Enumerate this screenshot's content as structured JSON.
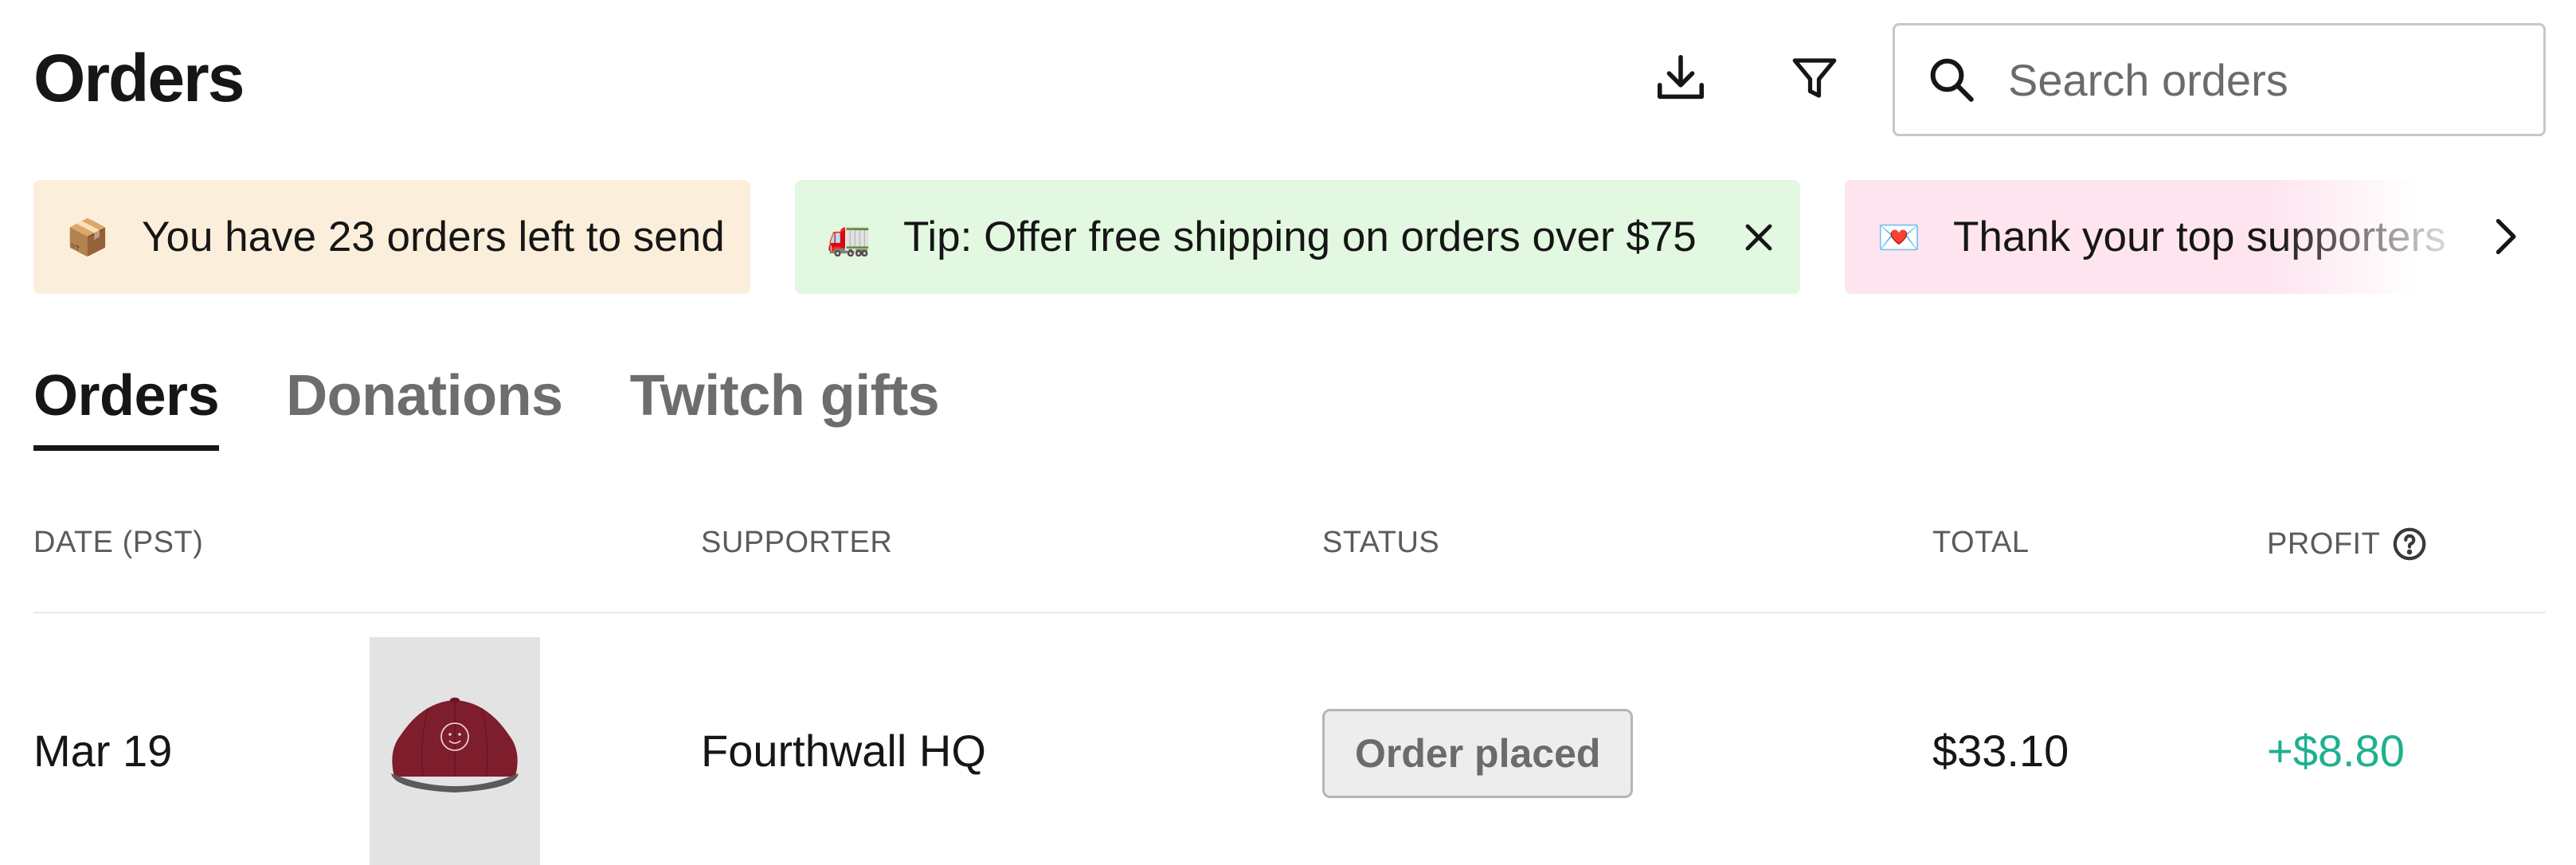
{
  "header": {
    "title": "Orders",
    "download_icon": "download-icon",
    "filter_icon": "filter-icon",
    "search": {
      "placeholder": "Search orders",
      "value": ""
    }
  },
  "banners": [
    {
      "emoji": "📦",
      "text": "You have 23 orders left to send",
      "color": "#fbefdc"
    },
    {
      "emoji": "🚛",
      "text": "Tip: Offer free shipping on orders over $75",
      "color": "#e2f8e1",
      "dismissible": true
    },
    {
      "emoji": "💌",
      "text": "Thank your top supporters",
      "color": "#fde4ef"
    }
  ],
  "tabs": [
    {
      "label": "Orders",
      "active": true
    },
    {
      "label": "Donations",
      "active": false
    },
    {
      "label": "Twitch gifts",
      "active": false
    }
  ],
  "table": {
    "columns": [
      "DATE (PST)",
      "SUPPORTER",
      "STATUS",
      "TOTAL",
      "PROFIT"
    ],
    "rows": [
      {
        "date": "Mar 19",
        "product_image": "maroon-cap",
        "supporter": "Fourthwall HQ",
        "status": "Order placed",
        "total": "$33.10",
        "profit": "+$8.80"
      }
    ]
  },
  "colors": {
    "profit_positive": "#1fb08f",
    "text_primary": "#161616",
    "text_muted": "#6d6d6d"
  }
}
